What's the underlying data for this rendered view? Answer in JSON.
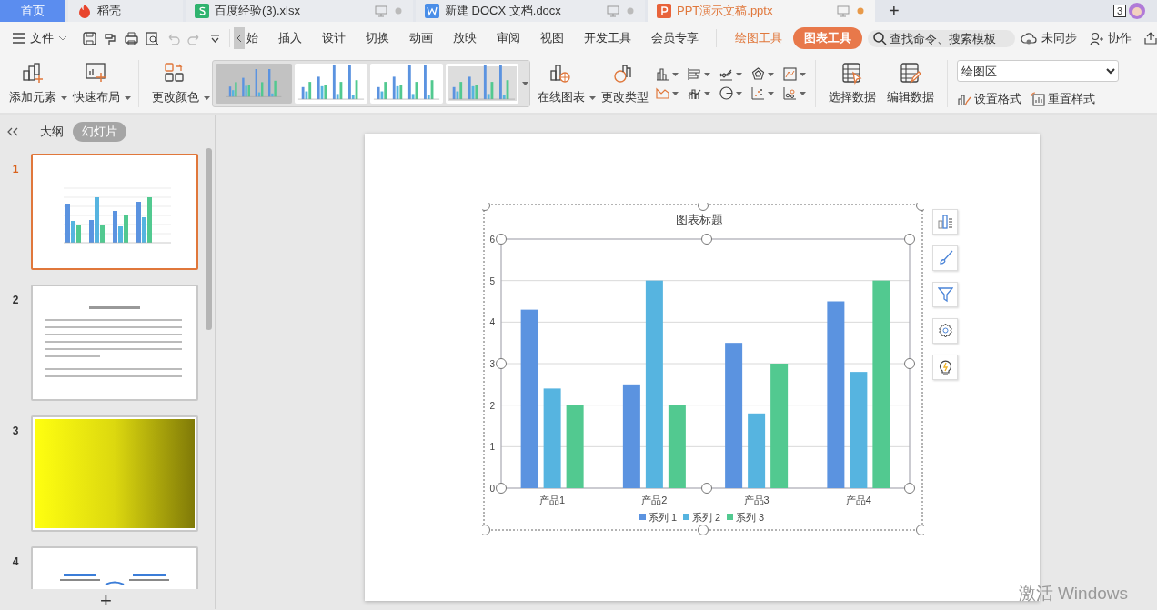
{
  "tabs": [
    {
      "label": "首页",
      "kind": "home",
      "selected": false
    },
    {
      "label": "稻壳",
      "kind": "docer",
      "selected": false
    },
    {
      "label": "百度经验(3).xlsx",
      "kind": "sheet",
      "selected": false
    },
    {
      "label": "新建 DOCX 文档.docx",
      "kind": "doc",
      "selected": false
    },
    {
      "label": "PPT演示文稿.pptx",
      "kind": "ppt",
      "selected": true
    }
  ],
  "new_tab": "+",
  "window_count": "3",
  "menu": {
    "file": "文件",
    "ribbon_tabs": [
      {
        "label": "始",
        "selected": false
      },
      {
        "label": "插入",
        "selected": false
      },
      {
        "label": "设计",
        "selected": false
      },
      {
        "label": "切换",
        "selected": false
      },
      {
        "label": "动画",
        "selected": false
      },
      {
        "label": "放映",
        "selected": false
      },
      {
        "label": "审阅",
        "selected": false
      },
      {
        "label": "视图",
        "selected": false
      },
      {
        "label": "开发工具",
        "selected": false
      },
      {
        "label": "会员专享",
        "selected": false
      }
    ],
    "context_tabs": [
      {
        "label": "绘图工具",
        "selected": false
      },
      {
        "label": "图表工具",
        "selected": true
      }
    ],
    "search": {
      "placeholder": "查找命令、搜索模板"
    },
    "sync": "未同步",
    "collab": "协作"
  },
  "toolbar": {
    "add_element": "添加元素",
    "quick_layout": "快速布局",
    "change_color": "更改颜色",
    "styles": [
      {
        "selected": true
      },
      {
        "selected": false
      },
      {
        "selected": false
      },
      {
        "selected": false
      }
    ],
    "online_chart": "在线图表",
    "change_type": "更改类型",
    "select_data": "选择数据",
    "edit_data": "编辑数据",
    "element_select": "绘图区",
    "format": "设置格式",
    "reset_style": "重置样式"
  },
  "panel": {
    "tabs": [
      {
        "label": "大纲",
        "selected": false
      },
      {
        "label": "幻灯片",
        "selected": true
      }
    ],
    "slides": [
      {
        "number": "1",
        "kind": "chart",
        "selected": true
      },
      {
        "number": "2",
        "kind": "text",
        "selected": false
      },
      {
        "number": "3",
        "kind": "gradient",
        "selected": false
      },
      {
        "number": "4",
        "kind": "columns",
        "selected": false
      }
    ],
    "add": "+"
  },
  "slide": {
    "chart_data": {
      "type": "bar",
      "title": "图表标题",
      "categories": [
        "产品1",
        "产品2",
        "产品3",
        "产品4"
      ],
      "series": [
        {
          "name": "系列 1",
          "color": "#5b93e0",
          "values": [
            4.3,
            2.5,
            3.5,
            4.5
          ]
        },
        {
          "name": "系列 2",
          "color": "#56b4e0",
          "values": [
            2.4,
            5,
            1.8,
            2.8
          ]
        },
        {
          "name": "系列 3",
          "color": "#52c990",
          "values": [
            2,
            2,
            3,
            5
          ]
        }
      ],
      "ylim": [
        0,
        6
      ],
      "yticks": [
        0,
        1,
        2,
        3,
        4,
        5,
        6
      ],
      "grid": true,
      "legend": true
    }
  },
  "activation": "激活 Windows"
}
